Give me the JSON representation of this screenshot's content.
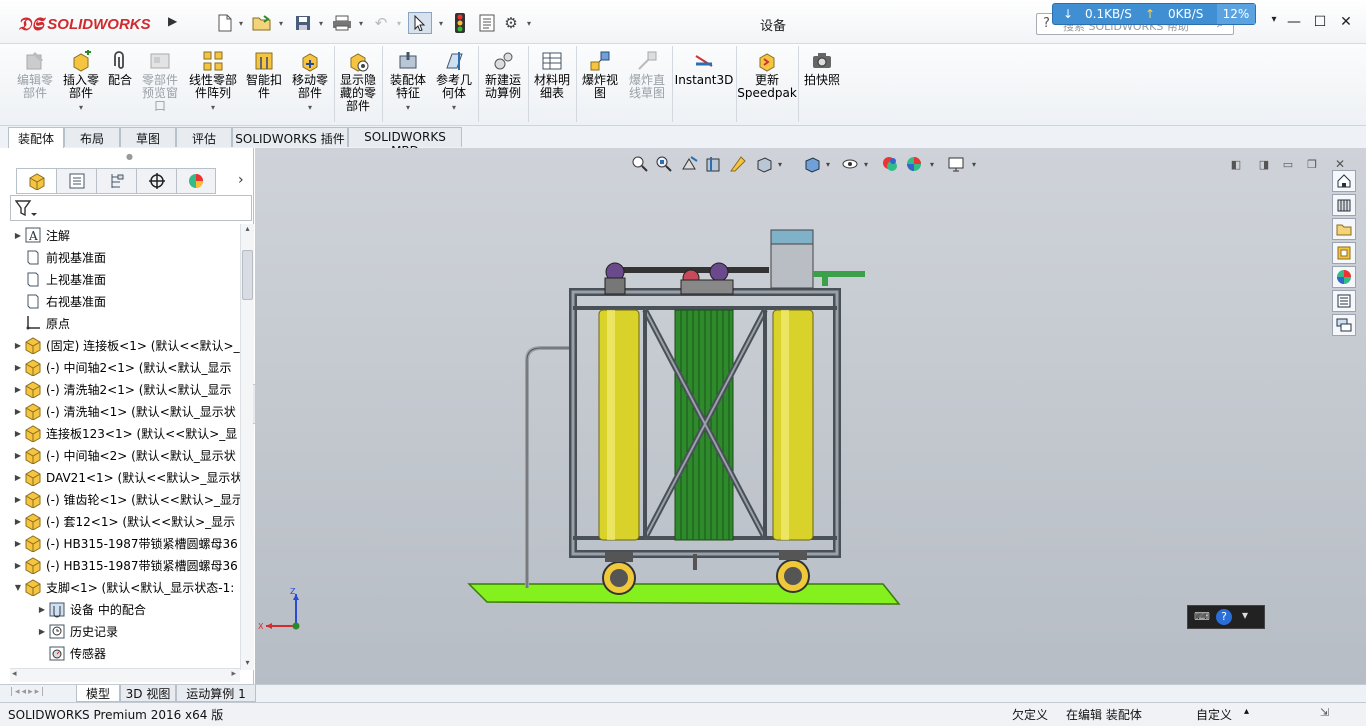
{
  "app": {
    "title": "设备",
    "brand": "SOLIDWORKS"
  },
  "netmon": {
    "down": "0.1KB/S",
    "up": "0KB/S",
    "percent": "12%"
  },
  "search": {
    "placeholder": "搜索 SOLIDWORKS 帮助"
  },
  "ribbon": {
    "buttons": [
      {
        "line1": "编辑零",
        "line2": "部件",
        "disabled": true
      },
      {
        "line1": "插入零",
        "line2": "部件"
      },
      {
        "line1": "配合",
        "line2": ""
      },
      {
        "line1": "零部件",
        "line2": "预览窗",
        "line3": "口",
        "disabled": true
      },
      {
        "line1": "线性零部",
        "line2": "件阵列"
      },
      {
        "line1": "智能扣",
        "line2": "件"
      },
      {
        "line1": "移动零",
        "line2": "部件"
      },
      {
        "line1": "显示隐",
        "line2": "藏的零",
        "line3": "部件"
      },
      {
        "line1": "装配体",
        "line2": "特征"
      },
      {
        "line1": "参考几",
        "line2": "何体"
      },
      {
        "line1": "新建运",
        "line2": "动算例"
      },
      {
        "line1": "材料明",
        "line2": "细表"
      },
      {
        "line1": "爆炸视",
        "line2": "图"
      },
      {
        "line1": "爆炸直",
        "line2": "线草图",
        "disabled": true
      },
      {
        "line1": "Instant3D",
        "line2": ""
      },
      {
        "line1": "更新",
        "line2": "Speedpak"
      },
      {
        "line1": "拍快照",
        "line2": ""
      }
    ]
  },
  "command_tabs": [
    "装配体",
    "布局",
    "草图",
    "评估",
    "SOLIDWORKS 插件",
    "SOLIDWORKS MBD"
  ],
  "tree": {
    "items": [
      {
        "label": "注解",
        "icon": "annotation-icon",
        "expand": true,
        "indent": 0
      },
      {
        "label": "前视基准面",
        "icon": "plane-icon",
        "expand": false,
        "indent": 0
      },
      {
        "label": "上视基准面",
        "icon": "plane-icon",
        "expand": false,
        "indent": 0
      },
      {
        "label": "右视基准面",
        "icon": "plane-icon",
        "expand": false,
        "indent": 0
      },
      {
        "label": "原点",
        "icon": "origin-icon",
        "expand": false,
        "indent": 0
      },
      {
        "label": "(固定) 连接板<1> (默认<<默认>_",
        "icon": "part-icon",
        "expand": true,
        "indent": 0
      },
      {
        "label": "(-) 中间轴2<1> (默认<默认_显示",
        "icon": "part-icon",
        "expand": true,
        "indent": 0
      },
      {
        "label": "(-) 清洗轴2<1> (默认<默认_显示",
        "icon": "part-icon",
        "expand": true,
        "indent": 0
      },
      {
        "label": "(-) 清洗轴<1> (默认<默认_显示状",
        "icon": "part-icon",
        "expand": true,
        "indent": 0
      },
      {
        "label": "连接板123<1> (默认<<默认>_显",
        "icon": "part-icon",
        "expand": true,
        "indent": 0
      },
      {
        "label": "(-) 中间轴<2> (默认<默认_显示状",
        "icon": "part-icon",
        "expand": true,
        "indent": 0
      },
      {
        "label": "DAV21<1> (默认<<默认>_显示状",
        "icon": "part-icon",
        "expand": true,
        "indent": 0
      },
      {
        "label": "(-) 锥齿轮<1> (默认<<默认>_显示",
        "icon": "part-icon",
        "expand": true,
        "indent": 0
      },
      {
        "label": "(-) 套12<1> (默认<<默认>_显示",
        "icon": "part-icon",
        "expand": true,
        "indent": 0
      },
      {
        "label": "(-) HB315-1987带锁紧槽圆螺母36",
        "icon": "part-icon",
        "expand": true,
        "indent": 0
      },
      {
        "label": "(-) HB315-1987带锁紧槽圆螺母36",
        "icon": "part-icon",
        "expand": true,
        "indent": 0
      },
      {
        "label": "支脚<1> (默认<默认_显示状态-1:",
        "icon": "part-icon",
        "expand": "open",
        "indent": 0
      },
      {
        "label": "设备 中的配合",
        "icon": "mates-icon",
        "expand": true,
        "indent": 1
      },
      {
        "label": "历史记录",
        "icon": "history-icon",
        "expand": true,
        "indent": 1
      },
      {
        "label": "传感器",
        "icon": "sensor-icon",
        "expand": false,
        "indent": 1
      }
    ]
  },
  "bottom_tabs": [
    "模型",
    "3D 视图",
    "运动算例 1"
  ],
  "status": {
    "product": "SOLIDWORKS Premium 2016 x64 版",
    "definition": "欠定义",
    "editing": "在编辑 装配体",
    "units": "自定义"
  },
  "triad": {
    "z": "Z",
    "x": "X"
  }
}
